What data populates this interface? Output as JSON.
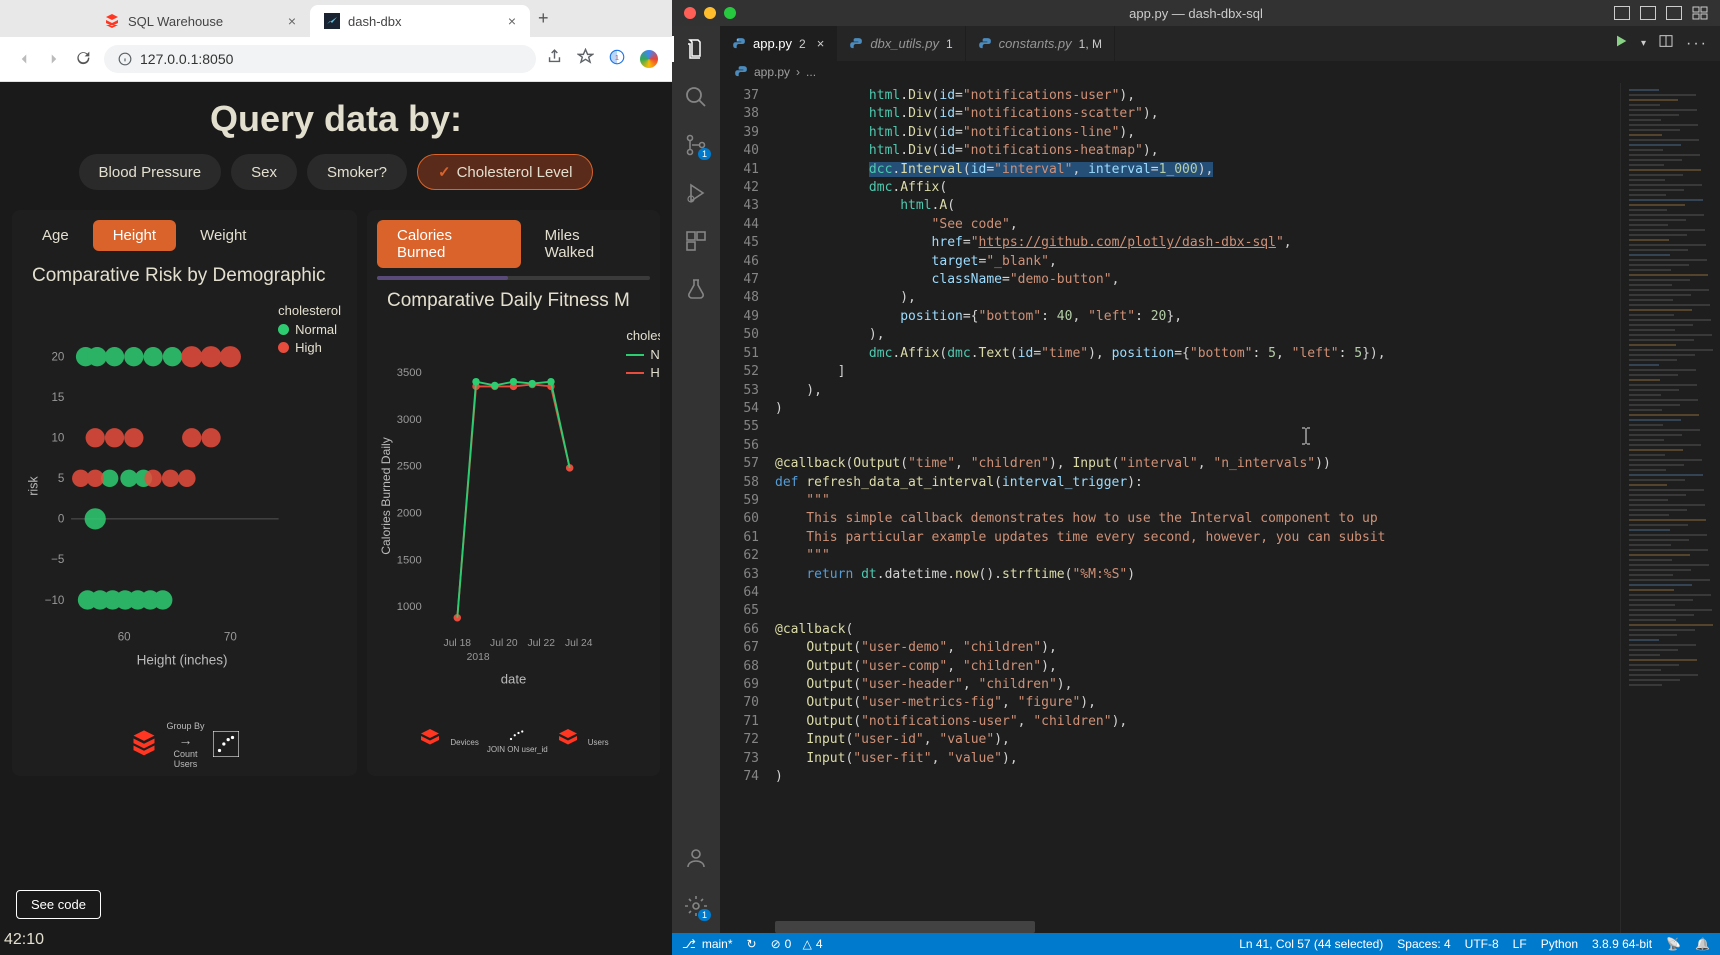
{
  "browser": {
    "tabs": [
      {
        "label": "SQL Warehouse",
        "active": false
      },
      {
        "label": "dash-dbx",
        "active": true
      }
    ],
    "url": "127.0.0.1:8050"
  },
  "dash": {
    "title": "Query data by:",
    "filters": [
      "Blood Pressure",
      "Sex",
      "Smoker?",
      "Cholesterol Level"
    ],
    "filter_selected": "Cholesterol Level",
    "left_tabs": [
      "Age",
      "Height",
      "Weight"
    ],
    "left_tab_active": "Height",
    "right_tabs": [
      "Calories Burned",
      "Miles Walked"
    ],
    "right_tab_active": "Calories Burned",
    "left_chart_title": "Comparative Risk by Demographic",
    "right_chart_title": "Comparative Daily Fitness M",
    "see_code": "See code",
    "time": "42:10",
    "footer_left": {
      "line1": "Group By",
      "line2": "Count",
      "line3": "Users"
    },
    "footer_right": {
      "line1": "JOIN ON user_id",
      "l": "Devices",
      "r": "Users"
    },
    "legend": {
      "title": "cholesterol",
      "normal": "Normal",
      "high": "High"
    },
    "colors": {
      "normal": "#2ecc71",
      "high": "#e74c3c",
      "accent": "#d9632b"
    }
  },
  "chart_data": [
    {
      "type": "scatter",
      "title": "Comparative Risk by Demographic",
      "xlabel": "Height (inches)",
      "ylabel": "risk",
      "xlim": [
        55,
        75
      ],
      "ylim": [
        -12,
        22
      ],
      "xticks": [
        60,
        70
      ],
      "yticks": [
        -10,
        -5,
        0,
        5,
        10,
        15,
        20
      ],
      "series": [
        {
          "name": "Normal",
          "color": "#2ecc71",
          "points": [
            [
              57,
              20
            ],
            [
              58,
              20
            ],
            [
              60,
              20
            ],
            [
              62,
              20
            ],
            [
              64,
              20
            ],
            [
              66,
              20
            ],
            [
              59,
              5
            ],
            [
              61,
              5
            ],
            [
              63,
              5
            ],
            [
              57,
              0
            ],
            [
              56,
              -10
            ],
            [
              57,
              -10
            ],
            [
              58,
              -10
            ],
            [
              59,
              -10
            ],
            [
              60,
              -10
            ],
            [
              61,
              -10
            ],
            [
              62,
              -10
            ]
          ]
        },
        {
          "name": "High",
          "color": "#e74c3c",
          "points": [
            [
              68,
              20
            ],
            [
              70,
              20
            ],
            [
              72,
              20
            ],
            [
              58,
              10
            ],
            [
              60,
              10
            ],
            [
              62,
              10
            ],
            [
              68,
              10
            ],
            [
              70,
              10
            ],
            [
              55,
              5
            ],
            [
              57,
              5
            ],
            [
              64,
              5
            ],
            [
              66,
              5
            ],
            [
              68,
              5
            ]
          ]
        }
      ]
    },
    {
      "type": "line",
      "title": "Comparative Daily Fitness Metrics",
      "xlabel": "date",
      "ylabel": "Calories Burned Daily",
      "ylim": [
        800,
        3700
      ],
      "yticks": [
        1000,
        1500,
        2000,
        2500,
        3000,
        3500
      ],
      "x": [
        "Jul 18",
        "Jul 20",
        "Jul 22",
        "Jul 24"
      ],
      "x_year": "2018",
      "series": [
        {
          "name": "Normal",
          "color": "#2ecc71",
          "values": [
            900,
            3400,
            3350,
            3400,
            3380,
            3400,
            2400
          ]
        },
        {
          "name": "High",
          "color": "#e74c3c",
          "values": [
            900,
            3350,
            3350,
            3350,
            3370,
            3350,
            2400
          ]
        }
      ]
    }
  ],
  "vscode": {
    "window_title": "app.py — dash-dbx-sql",
    "tabs": [
      {
        "label": "app.py",
        "badge": "2",
        "active": true
      },
      {
        "label": "dbx_utils.py",
        "badge": "1",
        "active": false
      },
      {
        "label": "constants.py",
        "badge": "1, M",
        "active": false
      }
    ],
    "breadcrumb": [
      "app.py",
      "..."
    ],
    "source_control_badge": "1",
    "settings_badge": "1",
    "line_start": 37,
    "line_end": 74,
    "code_lines": [
      "            html.Div(id=\"notifications-user\"),",
      "            html.Div(id=\"notifications-scatter\"),",
      "            html.Div(id=\"notifications-line\"),",
      "            html.Div(id=\"notifications-heatmap\"),",
      "            dcc.Interval(id=\"interval\", interval=1_000),",
      "            dmc.Affix(",
      "                html.A(",
      "                    \"See code\",",
      "                    href=\"https://github.com/plotly/dash-dbx-sql\",",
      "                    target=\"_blank\",",
      "                    className=\"demo-button\",",
      "                ),",
      "                position={\"bottom\": 40, \"left\": 20},",
      "            ),",
      "            dmc.Affix(dmc.Text(id=\"time\"), position={\"bottom\": 5, \"left\": 5}),",
      "        ]",
      "    ),",
      ")",
      "",
      "",
      "@callback(Output(\"time\", \"children\"), Input(\"interval\", \"n_intervals\"))",
      "def refresh_data_at_interval(interval_trigger):",
      "    \"\"\"",
      "    This simple callback demonstrates how to use the Interval component to up",
      "    This particular example updates time every second, however, you can subsit",
      "    \"\"\"",
      "    return dt.datetime.now().strftime(\"%M:%S\")",
      "",
      "",
      "@callback(",
      "    Output(\"user-demo\", \"children\"),",
      "    Output(\"user-comp\", \"children\"),",
      "    Output(\"user-header\", \"children\"),",
      "    Output(\"user-metrics-fig\", \"figure\"),",
      "    Output(\"notifications-user\", \"children\"),",
      "    Input(\"user-id\", \"value\"),",
      "    Input(\"user-fit\", \"value\"),",
      ")"
    ],
    "selected_line_index": 4,
    "status": {
      "branch": "main*",
      "errors": "0",
      "warnings": "4",
      "position": "Ln 41, Col 57 (44 selected)",
      "spaces": "Spaces: 4",
      "encoding": "UTF-8",
      "eol": "LF",
      "language": "Python",
      "interpreter": "3.8.9 64-bit"
    }
  }
}
